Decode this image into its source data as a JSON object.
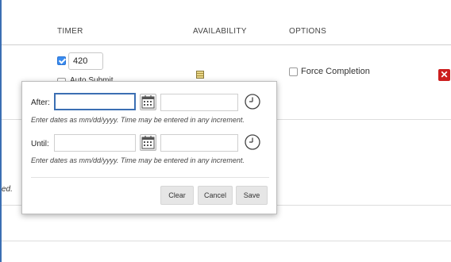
{
  "header": {
    "timer": "TIMER",
    "availability": "AVAILABILITY",
    "options": "OPTIONS"
  },
  "row": {
    "timer_enabled": true,
    "timer_value": "420",
    "auto_submit_label": "Auto Submit",
    "availability_icon": "calendar-grid-icon",
    "force_completion_label": "Force Completion",
    "delete_label": "✕"
  },
  "left_cut_text": "ed.",
  "popup": {
    "after_label": "After:",
    "after_date": "",
    "after_time": "",
    "until_label": "Until:",
    "until_date": "",
    "until_time": "",
    "hint": "Enter dates as mm/dd/yyyy. Time may be entered in any increment.",
    "buttons": {
      "clear": "Clear",
      "cancel": "Cancel",
      "save": "Save"
    }
  },
  "colors": {
    "accent_blue": "#3b6fb3",
    "checkbox_blue": "#3a8cf0",
    "delete_red": "#cc1f1f"
  }
}
